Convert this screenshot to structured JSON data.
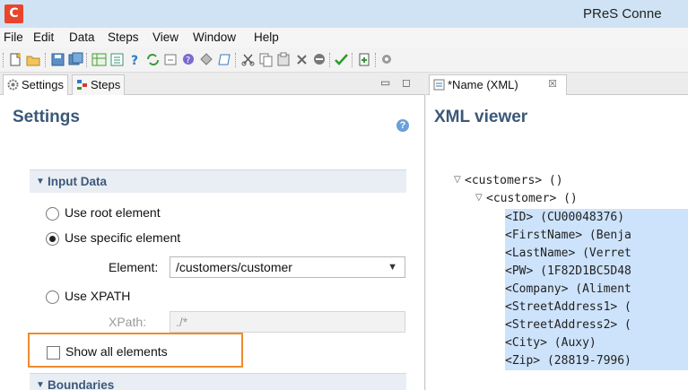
{
  "window": {
    "title": "PReS Conne",
    "logo_letter": "C"
  },
  "menu": [
    "File",
    "Edit",
    "Data",
    "Steps",
    "View",
    "Window",
    "Help"
  ],
  "left_tabs": [
    {
      "label": "Settings",
      "icon": "gear-icon"
    },
    {
      "label": "Steps",
      "icon": "steps-icon"
    }
  ],
  "settings": {
    "header": "Settings",
    "input_data_section": "Input Data",
    "use_root_label": "Use root element",
    "use_specific_label": "Use specific element",
    "element_label": "Element:",
    "element_value": "/customers/customer",
    "use_xpath_label": "Use XPATH",
    "xpath_label": "XPath:",
    "xpath_value": "./*",
    "show_all_label": "Show all elements",
    "show_all_checked": false,
    "selected_mode": "specific",
    "boundaries_section": "Boundaries"
  },
  "editor_tab": {
    "label": "*Name (XML)",
    "close": "☒"
  },
  "xml_viewer": {
    "title": "XML viewer",
    "root": "<customers> ()",
    "child": "<customer> ()",
    "fields": [
      "<ID> (CU00048376)",
      "<FirstName> (Benja",
      "<LastName> (Verret",
      "<PW> (1F82D1BC5D48",
      "<Company> (Aliment",
      "<StreetAddress1> (",
      "<StreetAddress2> (",
      "<City> (Auxy)",
      "<Zip> (28819-7996)"
    ]
  },
  "colors": {
    "accent": "#3b5878",
    "highlight": "#f08a2c",
    "selection": "#cde3fb",
    "logo": "#e8452c"
  }
}
